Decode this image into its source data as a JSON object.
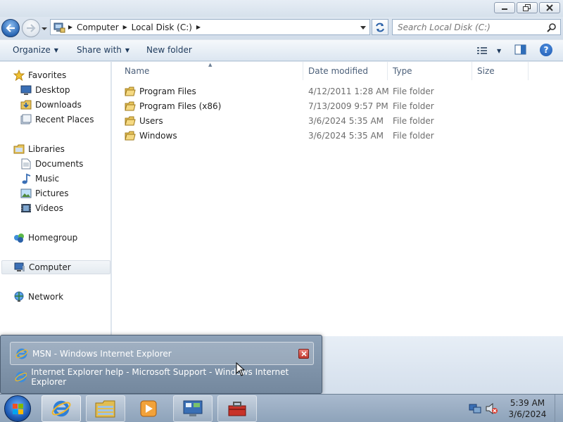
{
  "window": {
    "address": {
      "crumbs": [
        "Computer",
        "Local Disk (C:)"
      ]
    },
    "search": {
      "placeholder": "Search Local Disk (C:)"
    },
    "toolbar": {
      "organize": "Organize",
      "share_with": "Share with",
      "new_folder": "New folder"
    },
    "nav": {
      "favorites": {
        "label": "Favorites",
        "items": [
          "Desktop",
          "Downloads",
          "Recent Places"
        ]
      },
      "libraries": {
        "label": "Libraries",
        "items": [
          "Documents",
          "Music",
          "Pictures",
          "Videos"
        ]
      },
      "homegroup": "Homegroup",
      "computer": "Computer",
      "network": "Network"
    },
    "columns": {
      "name": "Name",
      "date": "Date modified",
      "type": "Type",
      "size": "Size"
    },
    "files": [
      {
        "name": "Program Files",
        "date": "4/12/2011 1:28 AM",
        "type": "File folder"
      },
      {
        "name": "Program Files (x86)",
        "date": "7/13/2009 9:57 PM",
        "type": "File folder"
      },
      {
        "name": "Users",
        "date": "3/6/2024 5:35 AM",
        "type": "File folder"
      },
      {
        "name": "Windows",
        "date": "3/6/2024 5:35 AM",
        "type": "File folder"
      }
    ]
  },
  "ie_popup": {
    "items": [
      "MSN - Windows Internet Explorer",
      "Internet Explorer help - Microsoft Support - Windows Internet Explorer"
    ]
  },
  "taskbar": {
    "clock": {
      "time": "5:39 AM",
      "date": "3/6/2024"
    },
    "pinned": [
      "internet-explorer-icon",
      "windows-explorer-icon",
      "media-player-icon",
      "control-panel-icon",
      "toolbox-icon"
    ]
  }
}
